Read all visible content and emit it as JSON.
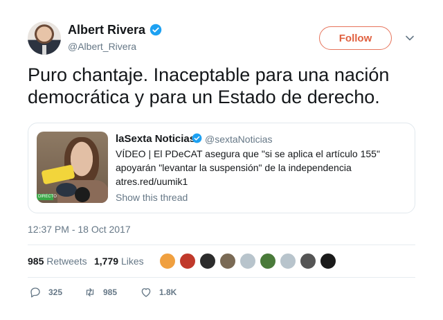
{
  "author": {
    "display_name": "Albert Rivera",
    "handle": "@Albert_Rivera"
  },
  "follow_label": "Follow",
  "tweet_text": "Puro chantaje. Inaceptable para una nación democrática y para un Estado de derecho.",
  "quoted": {
    "display_name": "laSexta Noticias",
    "handle": "@sextaNoticias",
    "line1": "VÍDEO | El PDeCAT asegura que \"si se aplica el artículo 155\"",
    "line2": "apoyarán \"levantar la suspensión\" de la independencia",
    "line3": "atres.red/uumik1",
    "show_thread": "Show this thread",
    "media_badge": "DIRECTO"
  },
  "timestamp": "12:37 PM - 18 Oct 2017",
  "stats": {
    "retweets_count": "985",
    "retweets_label": "Retweets",
    "likes_count": "1,779",
    "likes_label": "Likes"
  },
  "likers": [
    "#f0a040",
    "#c0392b",
    "#2c2c2c",
    "#7a6a55",
    "#b8c4cc",
    "#4a7a3a",
    "#b8c4cc",
    "#555555",
    "#1a1a1a"
  ],
  "actions": {
    "reply_count": "325",
    "retweet_count": "985",
    "like_count": "1.8K"
  },
  "colors": {
    "accent": "#e0603f",
    "verified": "#1da1f2",
    "muted": "#657786"
  }
}
